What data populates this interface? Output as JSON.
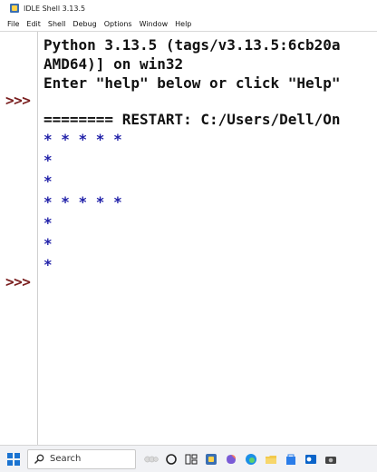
{
  "window": {
    "title": "IDLE Shell 3.13.5"
  },
  "menu": {
    "items": [
      "File",
      "Edit",
      "Shell",
      "Debug",
      "Options",
      "Window",
      "Help"
    ]
  },
  "shell": {
    "banner_line1": "Python 3.13.5 (tags/v3.13.5:6cb20a",
    "banner_line2": "AMD64)] on win32",
    "banner_line3": "Enter \"help\" below or click \"Help\"",
    "restart_line": "======== RESTART: C:/Users/Dell/On",
    "output_lines": [
      "* * * * *",
      "*",
      "*",
      "* * * * *",
      "*",
      "*",
      "*"
    ],
    "prompt": ">>>"
  },
  "taskbar": {
    "search_label": "Search"
  }
}
